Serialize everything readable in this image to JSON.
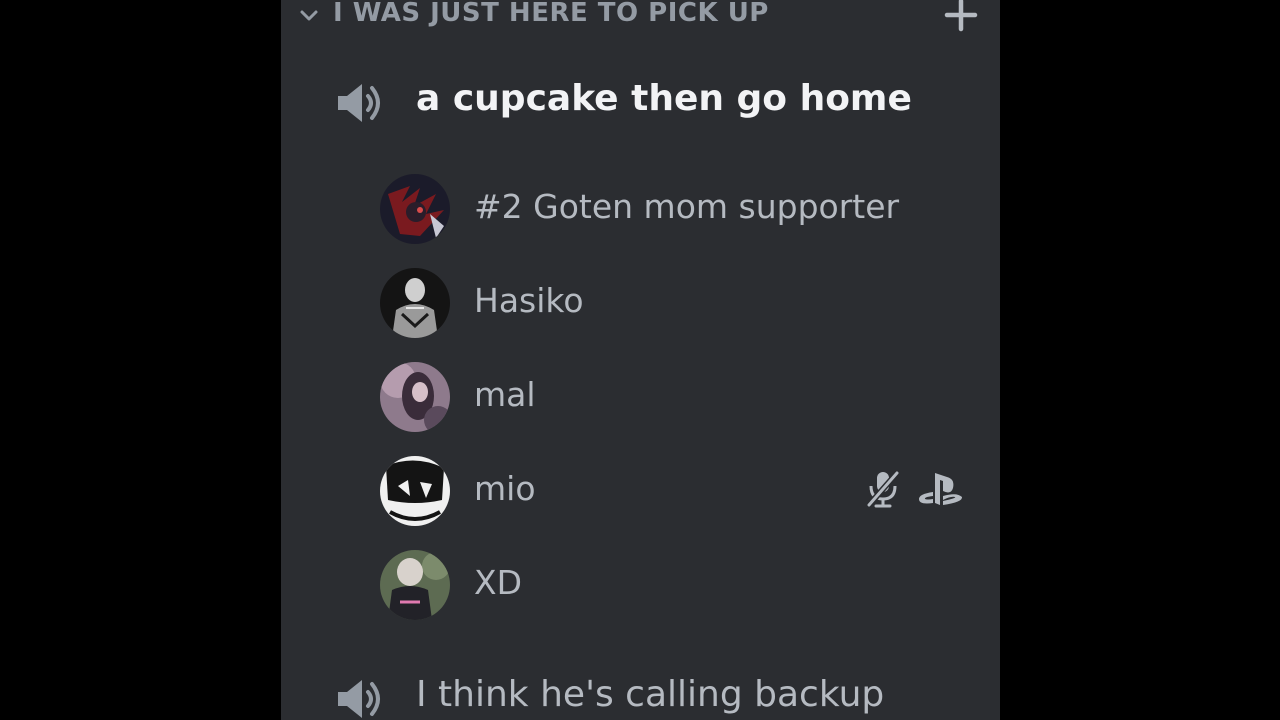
{
  "category": {
    "name": "I WAS JUST HERE TO PICK UP",
    "chevron_icon": "chevron-down-icon",
    "add_icon": "plus-icon"
  },
  "channels": [
    {
      "name": "a cupcake then go home",
      "icon": "speaker-icon",
      "active": true,
      "members": [
        {
          "name": "#2 Goten mom supporter",
          "avatar_colors": [
            "#7a1a1f",
            "#1b1b2a"
          ]
        },
        {
          "name": "Hasiko",
          "avatar_colors": [
            "#cfcfcf",
            "#1a1a1a"
          ]
        },
        {
          "name": "mal",
          "avatar_colors": [
            "#b59cae",
            "#3a2c3a"
          ]
        },
        {
          "name": "mio",
          "avatar_colors": [
            "#f0f0f0",
            "#141414"
          ],
          "icons": [
            "muted-mic-icon",
            "playstation-icon"
          ]
        },
        {
          "name": "XD",
          "avatar_colors": [
            "#7c8b6c",
            "#2a2a2a"
          ]
        }
      ]
    },
    {
      "name": "I think he's calling backup",
      "icon": "speaker-icon",
      "active": false
    }
  ],
  "colors": {
    "background": "#2b2d31",
    "outer": "#000000",
    "text_active": "#f2f3f5",
    "text_muted": "#b5bac1",
    "category_text": "#949ba4"
  }
}
